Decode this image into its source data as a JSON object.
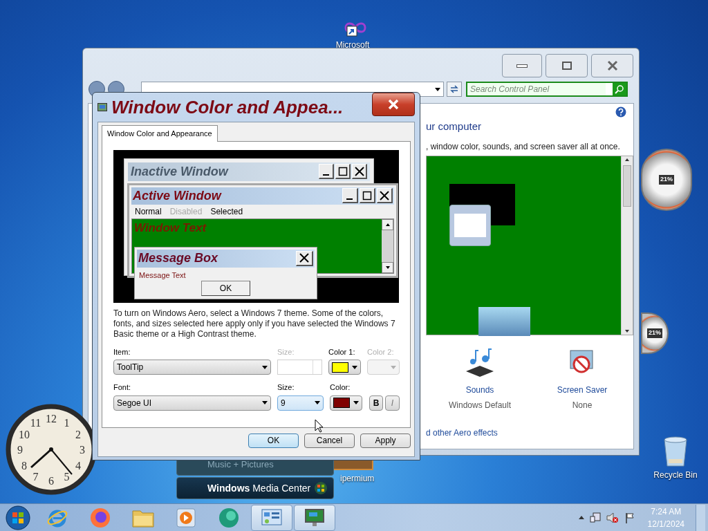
{
  "desktop": {
    "top_icon": {
      "label": "Microsoft"
    },
    "partial_icon": {
      "label": "ipermium"
    },
    "recycle_bin": {
      "label": "Recycle Bin"
    }
  },
  "control_panel": {
    "search": {
      "placeholder": "Search Control Panel"
    },
    "heading": "ur computer",
    "description": ", window color, sounds, and screen saver all at once.",
    "settings": [
      {
        "kind": "sounds",
        "label": "Sounds",
        "value": "Windows Default"
      },
      {
        "kind": "screensaver",
        "label": "Screen Saver",
        "value": "None"
      }
    ],
    "link": "d other Aero effects"
  },
  "dialog": {
    "title": "Window Color and Appea...",
    "tabs": [
      {
        "label": "Window Color and Appearance",
        "selected": true
      }
    ],
    "preview": {
      "inactive_title": "Inactive Window",
      "active_title": "Active Window",
      "menu": [
        {
          "label": "Normal",
          "disabled": false
        },
        {
          "label": "Disabled",
          "disabled": true
        },
        {
          "label": "Selected",
          "disabled": false
        }
      ],
      "window_text": "Window Text",
      "message_title": "Message Box",
      "message_text": "Message Text",
      "message_button": "OK"
    },
    "note": "To turn on Windows Aero, select a Windows 7 theme.  Some of the colors, fonts, and sizes selected here apply only if you have selected the Windows 7 Basic theme or a High Contrast theme.",
    "item": {
      "label": "Item:",
      "value": "ToolTip"
    },
    "item_size": {
      "label": "Size:",
      "disabled": true
    },
    "color1": {
      "label": "Color 1:",
      "color": "#ffff00",
      "disabled": false
    },
    "color2": {
      "label": "Color 2:",
      "disabled": true
    },
    "font": {
      "label": "Font:",
      "value": "Segoe UI"
    },
    "font_size": {
      "label": "Size:",
      "value": "9"
    },
    "font_color": {
      "label": "Color:",
      "color": "#800000"
    },
    "bold": {
      "label": "B"
    },
    "italic": {
      "label": "I"
    },
    "buttons": [
      {
        "label": "OK",
        "default": true
      },
      {
        "label": "Cancel",
        "default": false
      },
      {
        "label": "Apply",
        "default": false
      }
    ]
  },
  "gadgets": {
    "clock_numerals": [
      "12",
      "11",
      "1",
      "10",
      "2",
      "9",
      "3",
      "8",
      "4",
      "7",
      "5",
      "6"
    ],
    "cpu_meters": [
      {
        "reading": "21%"
      },
      {
        "reading": "21%"
      }
    ],
    "media_center": [
      {
        "label": "Music + Pictures"
      },
      {
        "label": "**Windows** Media Center"
      }
    ]
  },
  "taskbar": {
    "items": [
      {
        "kind": "start",
        "active": false
      },
      {
        "kind": "ie",
        "active": false
      },
      {
        "kind": "firefox",
        "active": false
      },
      {
        "kind": "folder",
        "active": false
      },
      {
        "kind": "media",
        "active": false
      },
      {
        "kind": "sphere",
        "active": false
      },
      {
        "kind": "control-panel",
        "active": true
      },
      {
        "kind": "display",
        "active": true
      }
    ],
    "time": "7:24 AM",
    "date": "12/1/2024"
  }
}
